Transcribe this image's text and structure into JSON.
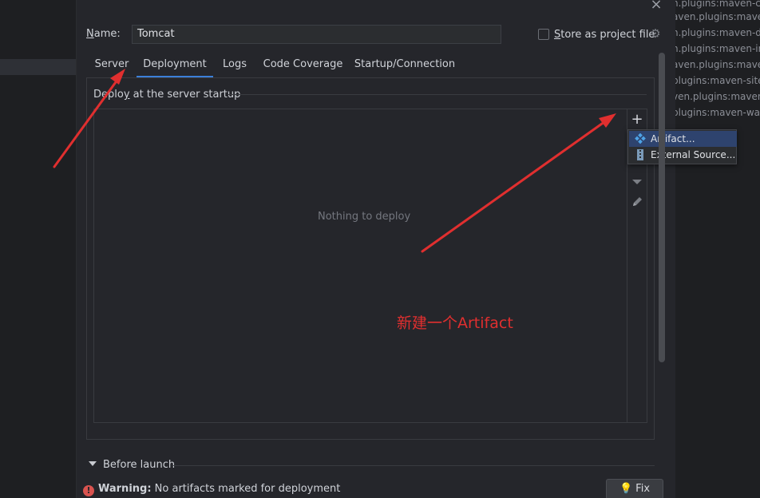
{
  "dialog": {
    "name_label_mnemonic": "N",
    "name_label_rest": "ame:",
    "name_value": "Tomcat",
    "store_label_mnemonic": "S",
    "store_label_rest": "tore as project file",
    "store_checked": false
  },
  "tabs": [
    {
      "label": "Server",
      "active": false
    },
    {
      "label": "Deployment",
      "active": true
    },
    {
      "label": "Logs",
      "active": false
    },
    {
      "label": "Code Coverage",
      "active": false
    },
    {
      "label": "Startup/Connection",
      "active": false
    }
  ],
  "deploy": {
    "section_title_pre": "Deplo",
    "section_title_mnemonic": "y",
    "section_title_post": " at the server startup",
    "empty_text": "Nothing to deploy",
    "toolbar": {
      "add_icon": "plus-icon",
      "move_down_icon": "arrow-down-icon",
      "edit_icon": "pencil-icon"
    },
    "popup": [
      {
        "label": "Artifact...",
        "icon": "artifact-icon",
        "selected": true
      },
      {
        "label": "External Source...",
        "icon": "archive-icon",
        "selected": false
      }
    ]
  },
  "annotation": {
    "text": "新建一个Artifact",
    "color": "#e02f2f"
  },
  "before_launch": {
    "label": "Before launch",
    "mnemonic": "B"
  },
  "warning": {
    "bold": "Warning:",
    "text": " No artifacts marked for deployment",
    "icon": "error-icon"
  },
  "fix_button": {
    "label": "Fix",
    "icon": "bulb-icon"
  },
  "background_log": [
    "n.plugins:maven-cle",
    "aven.plugins:maven-d",
    "n.plugins:maven-d",
    "n.plugins:maven-in",
    "aven.plugins:mave",
    "plugins:maven-site",
    "ven.plugins:maven-",
    "plugins:maven-war"
  ],
  "colors": {
    "accent": "#3b7fd8",
    "selection": "#2e436e",
    "annotation": "#e02f2f"
  }
}
